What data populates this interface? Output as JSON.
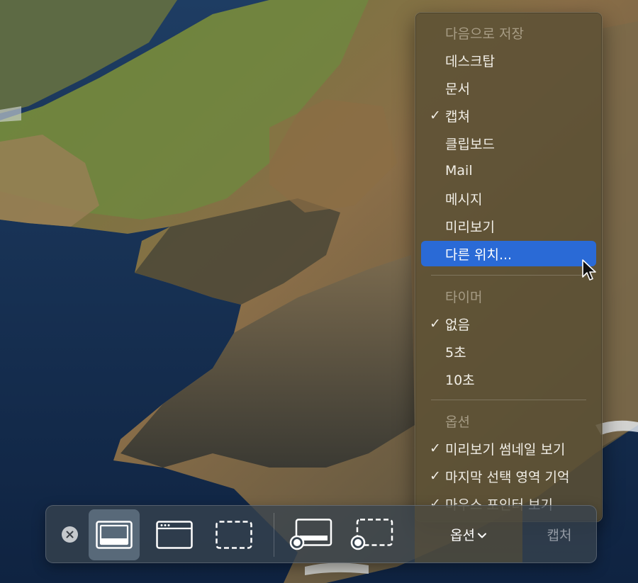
{
  "save_menu": {
    "header": "다음으로 저장",
    "items": [
      {
        "label": "데스크탑",
        "checked": false
      },
      {
        "label": "문서",
        "checked": false
      },
      {
        "label": "캡쳐",
        "checked": true
      },
      {
        "label": "클립보드",
        "checked": false
      },
      {
        "label": "Mail",
        "checked": false
      },
      {
        "label": "메시지",
        "checked": false
      },
      {
        "label": "미리보기",
        "checked": false
      },
      {
        "label": "다른 위치...",
        "checked": false,
        "highlighted": true
      }
    ]
  },
  "timer_menu": {
    "header": "타이머",
    "items": [
      {
        "label": "없음",
        "checked": true
      },
      {
        "label": "5초",
        "checked": false
      },
      {
        "label": "10초",
        "checked": false
      }
    ]
  },
  "options_menu": {
    "header": "옵션",
    "items": [
      {
        "label": "미리보기 썸네일 보기",
        "checked": true
      },
      {
        "label": "마지막 선택 영역 기억",
        "checked": true
      },
      {
        "label": "마우스 포인터 보기",
        "checked": true
      }
    ]
  },
  "toolbar": {
    "close_icon": "close-icon",
    "modes": [
      {
        "icon": "capture-entire-screen-icon",
        "active": true
      },
      {
        "icon": "capture-window-icon",
        "active": false
      },
      {
        "icon": "capture-selection-icon",
        "active": false
      },
      {
        "icon": "record-entire-screen-icon",
        "active": false
      },
      {
        "icon": "record-selection-icon",
        "active": false
      }
    ],
    "options_label": "옵션",
    "capture_label": "캡처"
  },
  "check_mark": "✓",
  "colors": {
    "menu_bg": "#5c5034",
    "highlight": "#2a6ad6",
    "toolbar_bg": "#37434e"
  }
}
